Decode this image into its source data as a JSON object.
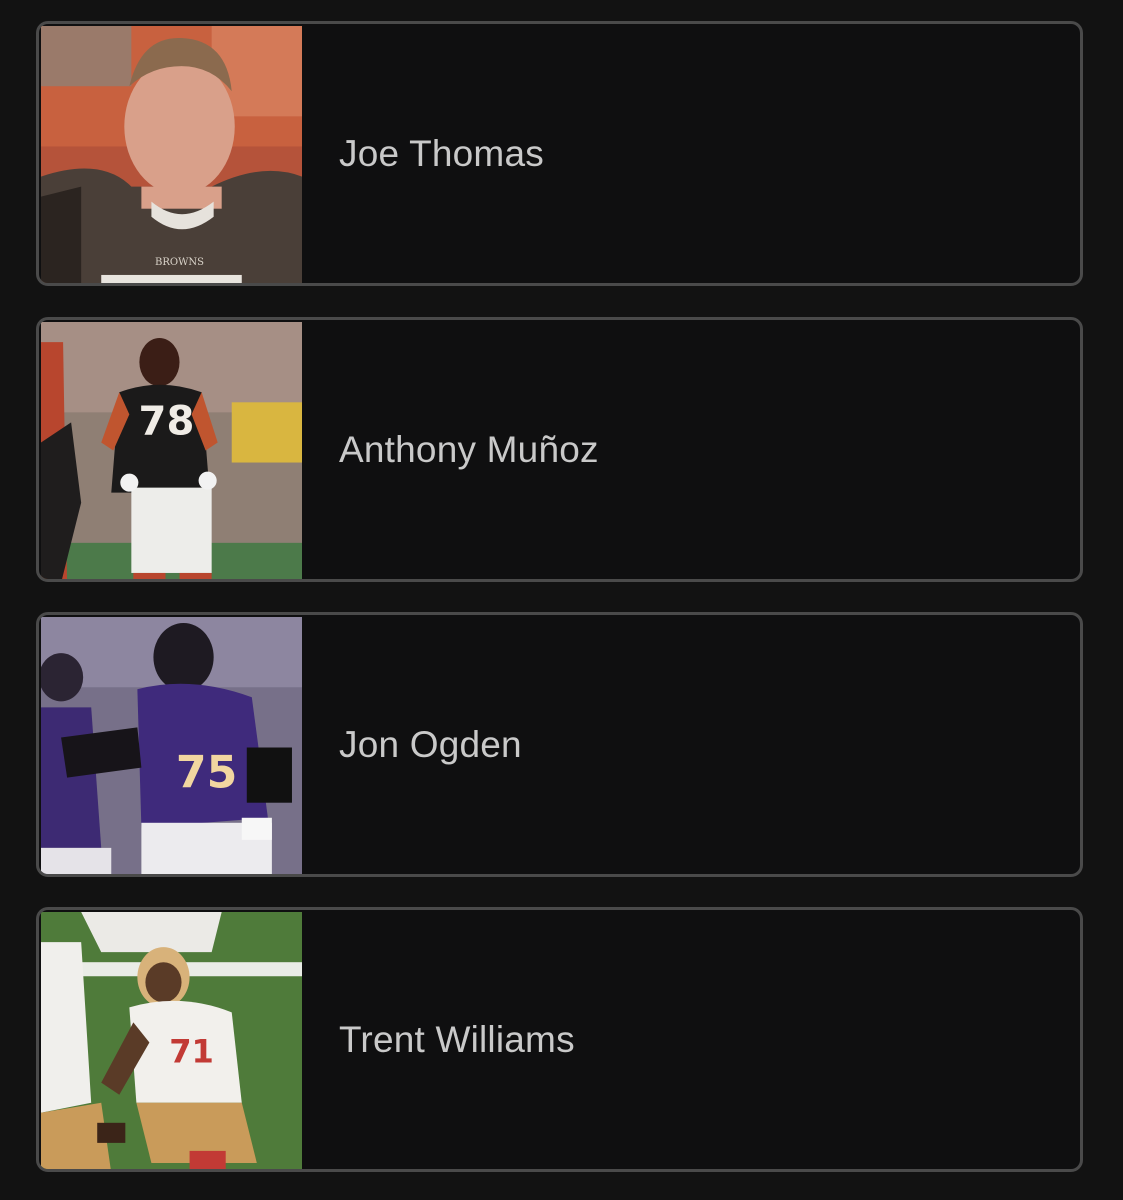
{
  "players": [
    {
      "name": "Joe Thomas",
      "photo_icon": "player-photo-icon"
    },
    {
      "name": "Anthony Muñoz",
      "photo_icon": "player-photo-icon"
    },
    {
      "name": "Jon Ogden",
      "photo_icon": "player-photo-icon"
    },
    {
      "name": "Trent Williams",
      "photo_icon": "player-photo-icon"
    }
  ],
  "colors": {
    "background": "#121212",
    "card_border": "#4a4a4a",
    "name_text": "#c9c9c9"
  }
}
